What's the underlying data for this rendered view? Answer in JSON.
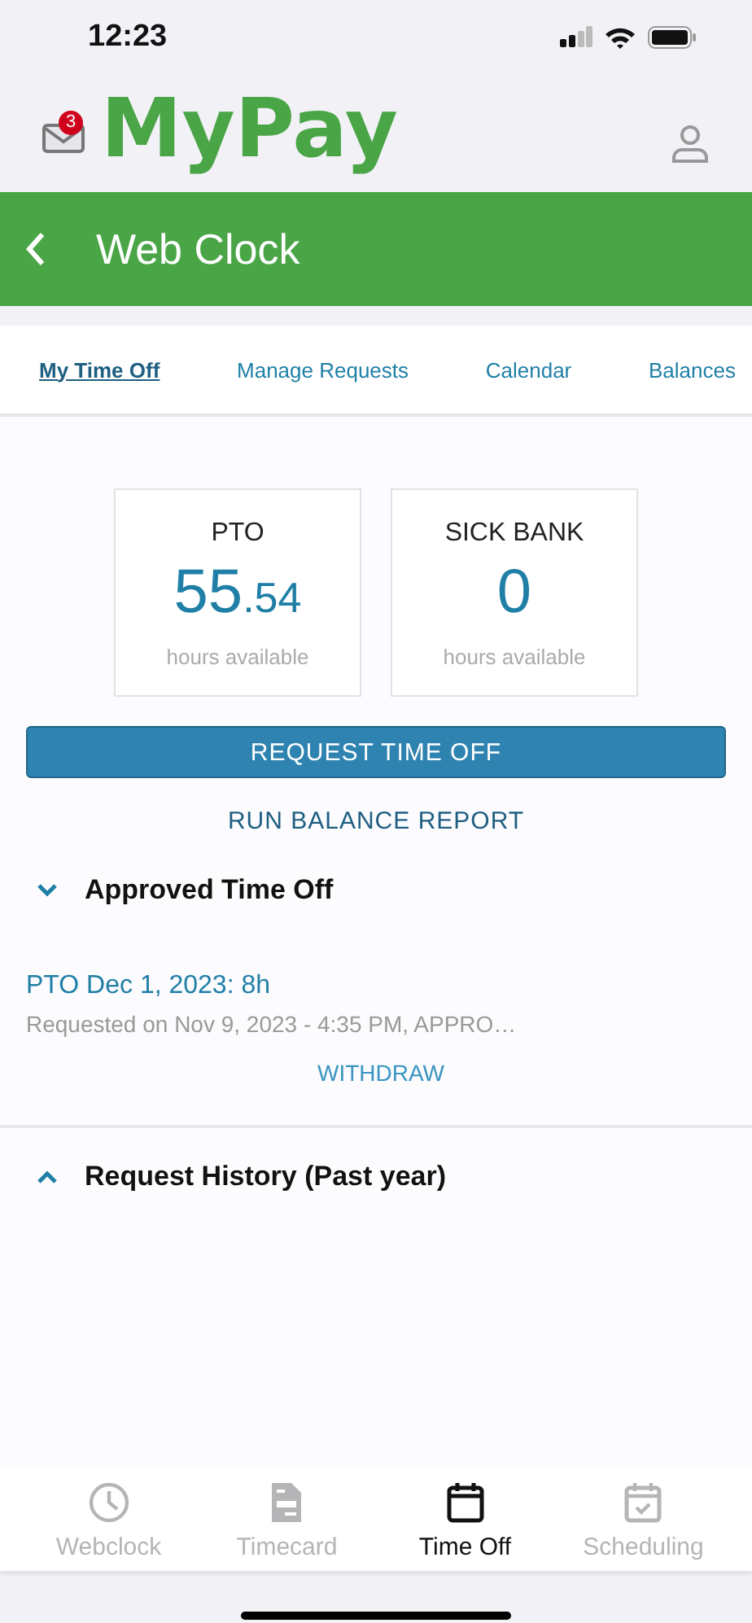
{
  "status_bar": {
    "time": "12:23"
  },
  "header": {
    "logo": "MyPay",
    "mail_badge": "3"
  },
  "title_bar": {
    "title": "Web Clock"
  },
  "tabs": [
    {
      "label": "My Time Off",
      "selected": true
    },
    {
      "label": "Manage Requests",
      "selected": false
    },
    {
      "label": "Calendar",
      "selected": false
    },
    {
      "label": "Balances",
      "selected": false
    }
  ],
  "balances": [
    {
      "name": "PTO",
      "whole": "55",
      "fraction": ".54",
      "unit": "hours available"
    },
    {
      "name": "SICK BANK",
      "whole": "0",
      "unit": "hours available"
    }
  ],
  "request_button": "REQUEST TIME OFF",
  "report_link": "RUN BALANCE REPORT",
  "sections": [
    {
      "title": "Approved Time Off",
      "expanded": true,
      "items": [
        {
          "title": "PTO Dec 1, 2023: 8h",
          "detail": "Requested on Nov 9, 2023 - 4:35 PM, APPRO…",
          "action": "WITHDRAW"
        }
      ]
    },
    {
      "title": "Request History (Past year)",
      "expanded": false
    }
  ],
  "bottom_nav": [
    {
      "label": "Webclock",
      "kind": "clock",
      "selected": false
    },
    {
      "label": "Timecard",
      "kind": "document",
      "selected": false
    },
    {
      "label": "Time Off",
      "kind": "calendar",
      "selected": true
    },
    {
      "label": "Scheduling",
      "kind": "calendar-check",
      "selected": false
    }
  ]
}
